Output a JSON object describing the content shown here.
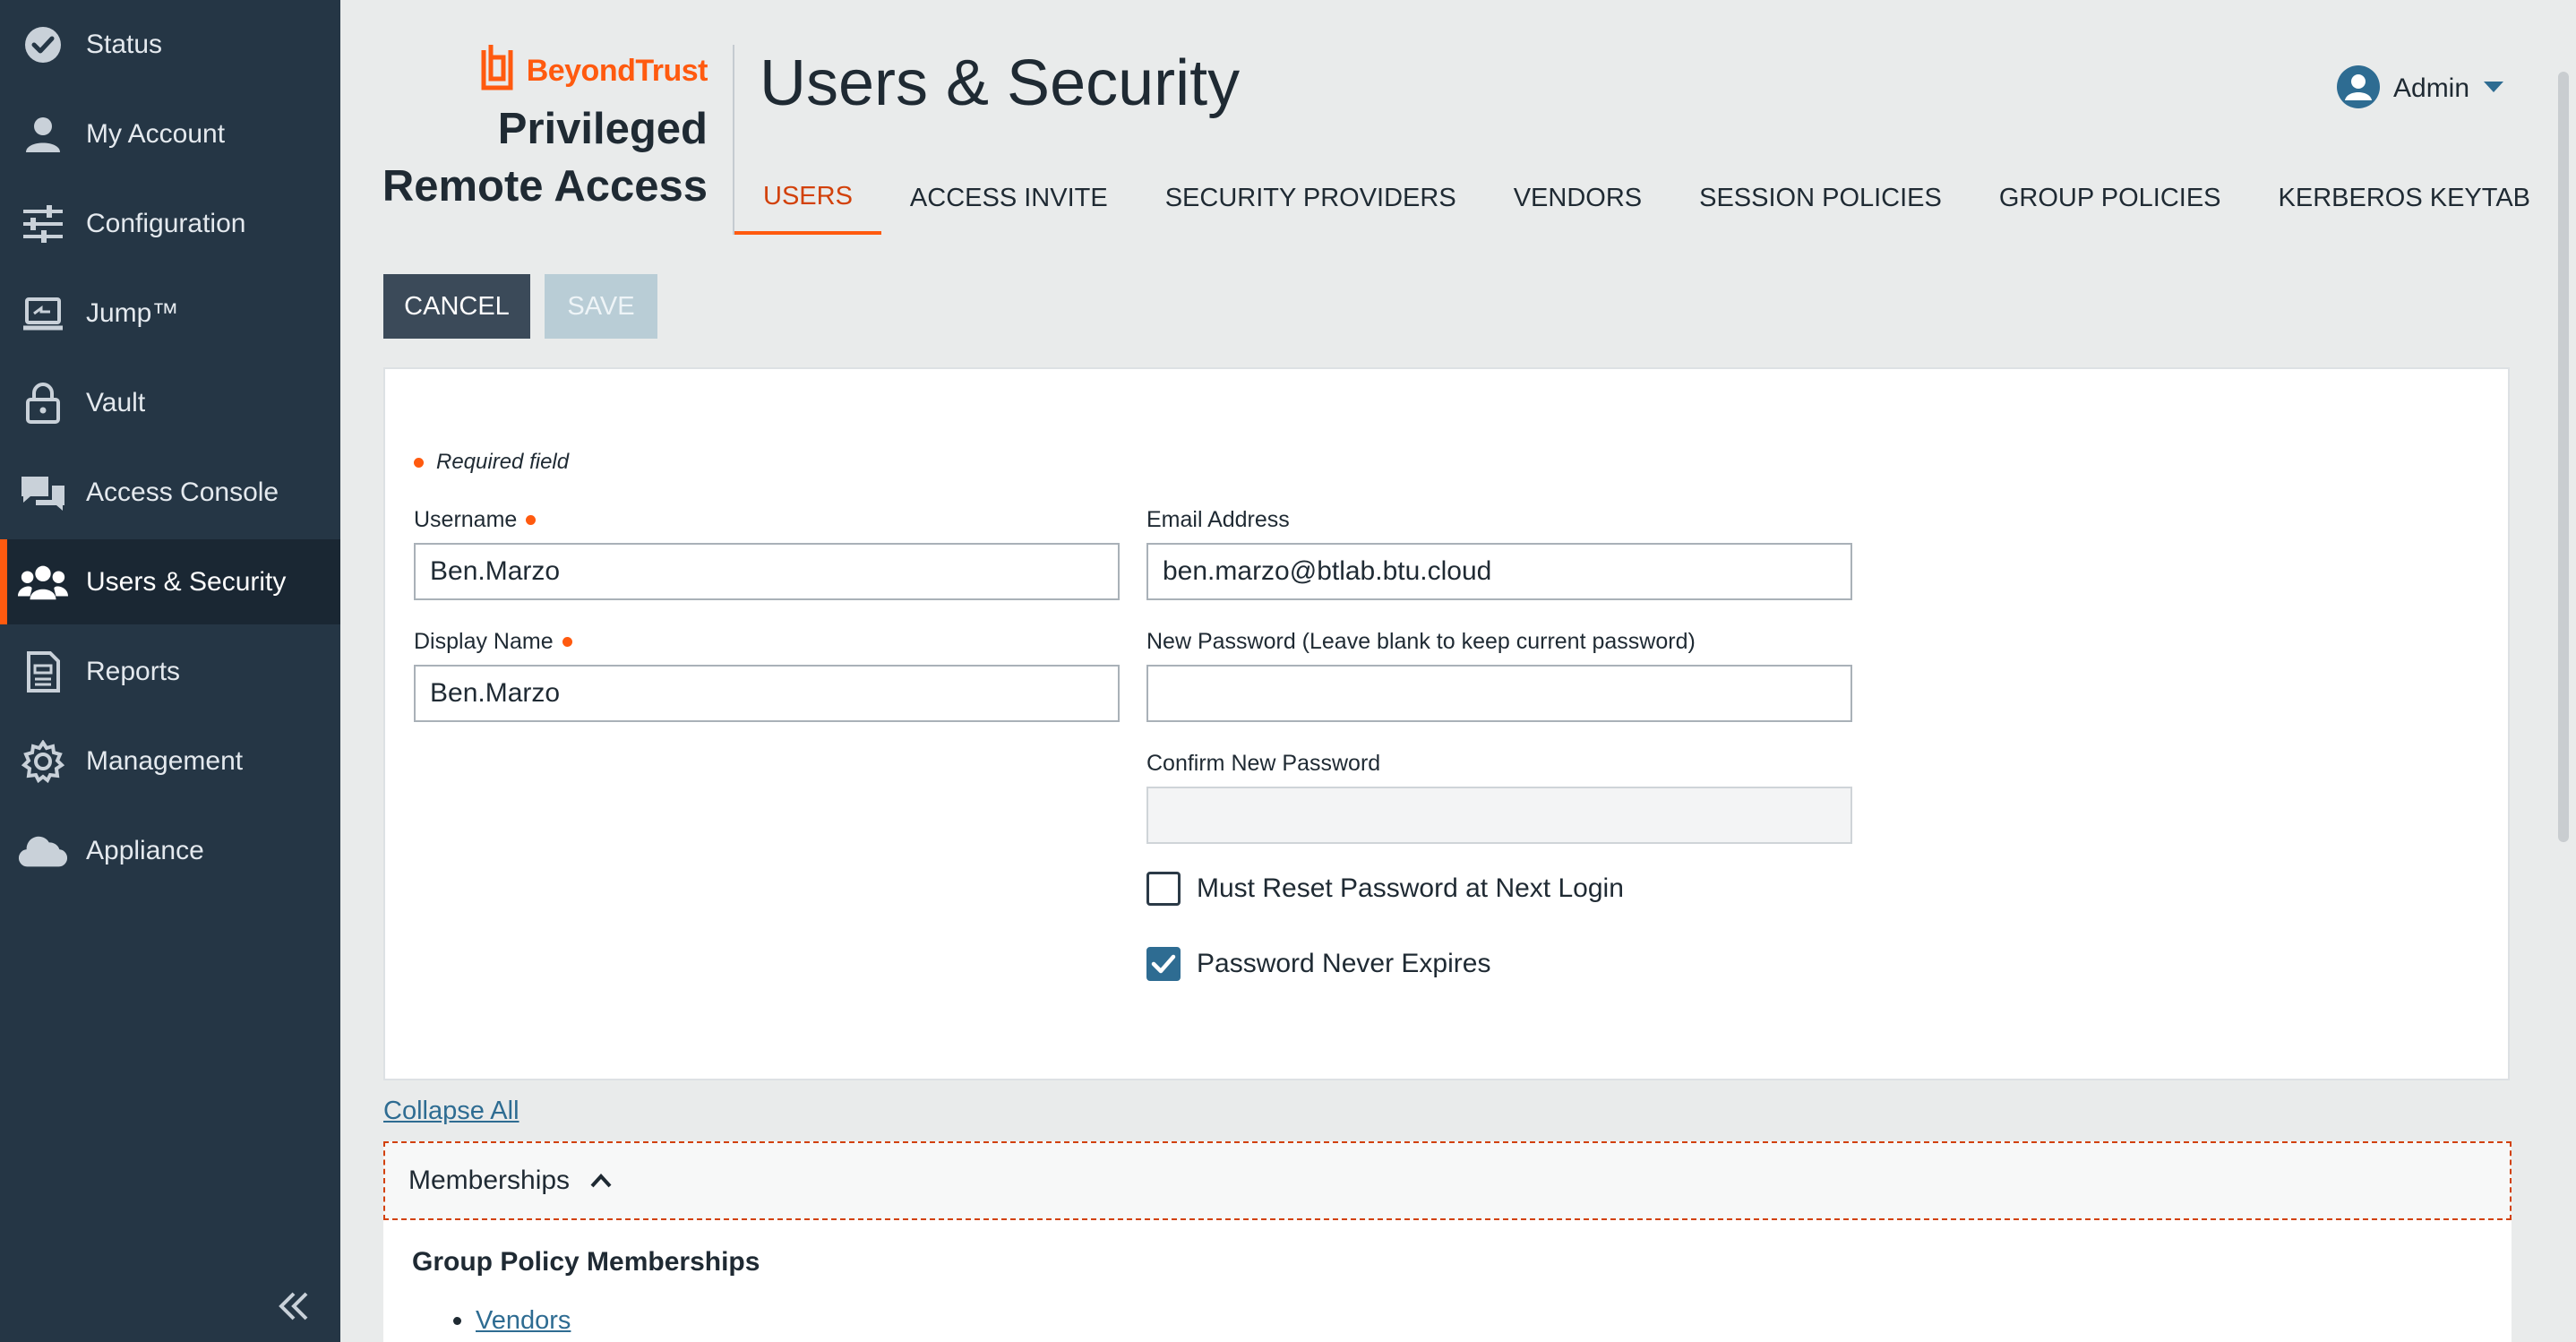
{
  "sidebar": {
    "items": [
      {
        "label": "Status",
        "icon": "check-circle-icon"
      },
      {
        "label": "My Account",
        "icon": "user-icon"
      },
      {
        "label": "Configuration",
        "icon": "sliders-icon"
      },
      {
        "label": "Jump™",
        "icon": "jump-laptop-icon"
      },
      {
        "label": "Vault",
        "icon": "lock-icon"
      },
      {
        "label": "Access Console",
        "icon": "chat-bubbles-icon"
      },
      {
        "label": "Users & Security",
        "icon": "users-icon",
        "active": true
      },
      {
        "label": "Reports",
        "icon": "report-icon"
      },
      {
        "label": "Management",
        "icon": "gear-icon"
      },
      {
        "label": "Appliance",
        "icon": "cloud-icon"
      }
    ],
    "collapse_icon": "double-chevron-left-icon"
  },
  "brand": {
    "company": "BeyondTrust",
    "product_line1": "Privileged",
    "product_line2": "Remote Access",
    "accent": "#ff5a0f"
  },
  "header": {
    "title": "Users & Security",
    "user_name": "Admin"
  },
  "tabs": [
    {
      "label": "USERS",
      "active": true
    },
    {
      "label": "ACCESS INVITE"
    },
    {
      "label": "SECURITY PROVIDERS"
    },
    {
      "label": "VENDORS"
    },
    {
      "label": "SESSION POLICIES"
    },
    {
      "label": "GROUP POLICIES"
    },
    {
      "label": "KERBEROS KEYTAB"
    }
  ],
  "actions": {
    "cancel_label": "CANCEL",
    "save_label": "SAVE"
  },
  "form": {
    "required_note": "Required field",
    "username": {
      "label": "Username",
      "value": "Ben.Marzo"
    },
    "display_name": {
      "label": "Display Name",
      "value": "Ben.Marzo"
    },
    "email": {
      "label": "Email Address",
      "value": "ben.marzo@btlab.btu.cloud"
    },
    "new_password": {
      "label": "New Password (Leave blank to keep current password)",
      "value": ""
    },
    "confirm_password": {
      "label": "Confirm New Password",
      "value": ""
    },
    "must_reset": {
      "label": "Must Reset Password at Next Login",
      "checked": false
    },
    "never_expires": {
      "label": "Password Never Expires",
      "checked": true
    }
  },
  "lower": {
    "collapse_all": "Collapse All",
    "memberships_label": "Memberships",
    "group_policy_title": "Group Policy Memberships",
    "group_policies": [
      "Vendors"
    ]
  }
}
